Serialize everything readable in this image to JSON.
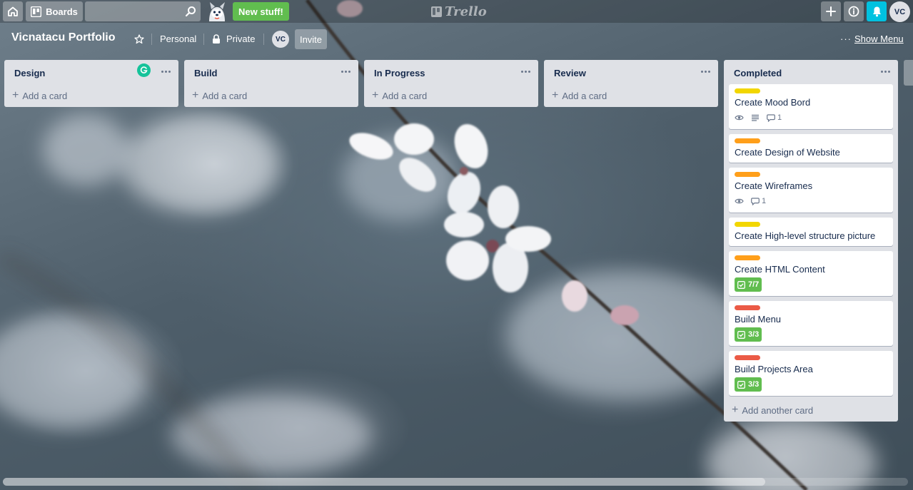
{
  "topbar": {
    "boards_label": "Boards",
    "search_value": "",
    "new_stuff_label": "New stuff!",
    "logo_text": "Trello",
    "avatar_initials": "VC"
  },
  "board": {
    "title": "Vicnatacu Portfolio",
    "team_label": "Personal",
    "visibility_label": "Private",
    "member_initials": "VC",
    "invite_label": "Invite",
    "show_menu_label": "Show Menu",
    "more_label": "···"
  },
  "lists": [
    {
      "title": "Design",
      "add_label": "Add a card"
    },
    {
      "title": "Build",
      "add_label": "Add a card"
    },
    {
      "title": "In Progress",
      "add_label": "Add a card"
    },
    {
      "title": "Review",
      "add_label": "Add a card"
    },
    {
      "title": "Completed",
      "add_label": "Add another card",
      "cards": [
        {
          "title": "Create Mood Bord",
          "label_color": "#f2d600",
          "comments": "1"
        },
        {
          "title": "Create Design of Website",
          "label_color": "#ff9f1a"
        },
        {
          "title": "Create Wireframes",
          "label_color": "#ff9f1a",
          "comments": "1"
        },
        {
          "title": "Create High-level structure picture",
          "label_color": "#f2d600"
        },
        {
          "title": "Create HTML Content",
          "label_color": "#ff9f1a",
          "checklist": "7/7"
        },
        {
          "title": "Build Menu",
          "label_color": "#eb5a46",
          "checklist": "3/3"
        },
        {
          "title": "Build Projects Area",
          "label_color": "#eb5a46",
          "checklist": "3/3"
        }
      ]
    }
  ],
  "colors": {
    "green": "#61bd4f",
    "bell": "#00c2e0",
    "list_bg": "#dfe1e6",
    "label_yellow": "#f2d600",
    "label_orange": "#ff9f1a",
    "label_red": "#eb5a46"
  }
}
